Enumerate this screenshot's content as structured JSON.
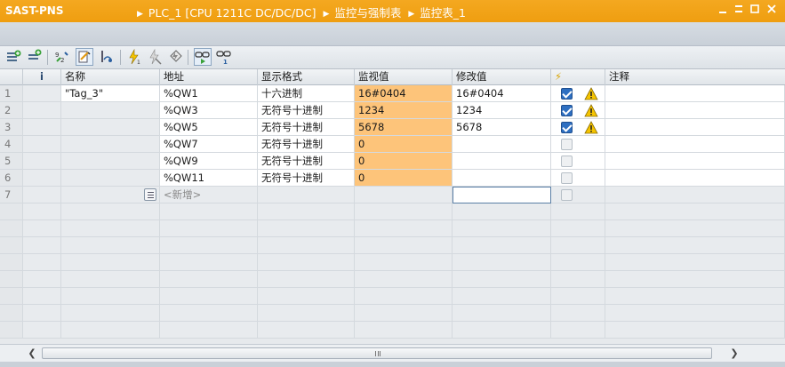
{
  "titlebar": {
    "project": "SAST-PNS",
    "breadcrumb": [
      "PLC_1 [CPU 1211C DC/DC/DC]",
      "监控与强制表",
      "监控表_1"
    ],
    "icons": [
      "minimize-icon",
      "restore-icon",
      "maximize-icon",
      "close-icon"
    ]
  },
  "toolbar": {
    "icons": [
      "insert-row-icon",
      "add-row-icon",
      "update-values-icon",
      "monitor-once-icon",
      "display-mode-icon",
      "force-icon",
      "unforce-icon",
      "stop-force-icon",
      "monitor-all-icon",
      "modify-once-icon"
    ]
  },
  "table": {
    "headers": {
      "info": "i",
      "name": "名称",
      "address": "地址",
      "format": "显示格式",
      "monitor": "监视值",
      "modify": "修改值",
      "flash": "⚡",
      "comment": "注释"
    },
    "rows": [
      {
        "num": "1",
        "name": "\"Tag_3\"",
        "address": "%QW1",
        "format": "十六进制",
        "monitor": "16#0404",
        "modify": "16#0404",
        "checked": true,
        "warn": true
      },
      {
        "num": "2",
        "name": "",
        "address": "%QW3",
        "format": "无符号十进制",
        "monitor": "1234",
        "modify": "1234",
        "checked": true,
        "warn": true
      },
      {
        "num": "3",
        "name": "",
        "address": "%QW5",
        "format": "无符号十进制",
        "monitor": "5678",
        "modify": "5678",
        "checked": true,
        "warn": true
      },
      {
        "num": "4",
        "name": "",
        "address": "%QW7",
        "format": "无符号十进制",
        "monitor": "0",
        "modify": "",
        "checked": false,
        "warn": false
      },
      {
        "num": "5",
        "name": "",
        "address": "%QW9",
        "format": "无符号十进制",
        "monitor": "0",
        "modify": "",
        "checked": false,
        "warn": false
      },
      {
        "num": "6",
        "name": "",
        "address": "%QW11",
        "format": "无符号十进制",
        "monitor": "0",
        "modify": "",
        "checked": false,
        "warn": false
      }
    ],
    "new_row": {
      "num": "7",
      "placeholder": "<新增>"
    },
    "empty_rows": 8
  },
  "colors": {
    "titlebar": "#f09f12",
    "monitor_cell": "#fdc47a",
    "checkbox_on": "#2e6fc1",
    "warning": "#f5c400"
  }
}
